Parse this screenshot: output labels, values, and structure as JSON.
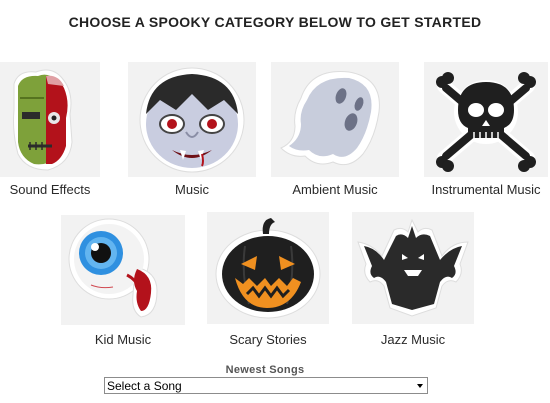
{
  "heading": "CHOOSE A SPOOKY CATEGORY BELOW TO GET STARTED",
  "categories": [
    {
      "label": "Sound Effects",
      "icon": "zombie-icon"
    },
    {
      "label": "Music",
      "icon": "vampire-icon"
    },
    {
      "label": "Ambient Music",
      "icon": "ghost-icon"
    },
    {
      "label": "Instrumental Music",
      "icon": "skull-crossbones-icon"
    },
    {
      "label": "Kid Music",
      "icon": "eyeball-icon"
    },
    {
      "label": "Scary Stories",
      "icon": "jack-o-lantern-icon"
    },
    {
      "label": "Jazz Music",
      "icon": "demon-bat-icon"
    }
  ],
  "newest_songs": {
    "title": "Newest Songs",
    "select_value": "Select a Song"
  },
  "colors": {
    "heading_text": "#222222",
    "tile_bg": "#f2f2f2",
    "zombie_green": "#7ea13a",
    "vampire_skin": "#c9cde0",
    "ghost": "#c8cddc",
    "pumpkin": "#1f1f1f",
    "pumpkin_glow": "#f09020",
    "eye_iris": "#2f90e0",
    "blood": "#b3121b"
  }
}
